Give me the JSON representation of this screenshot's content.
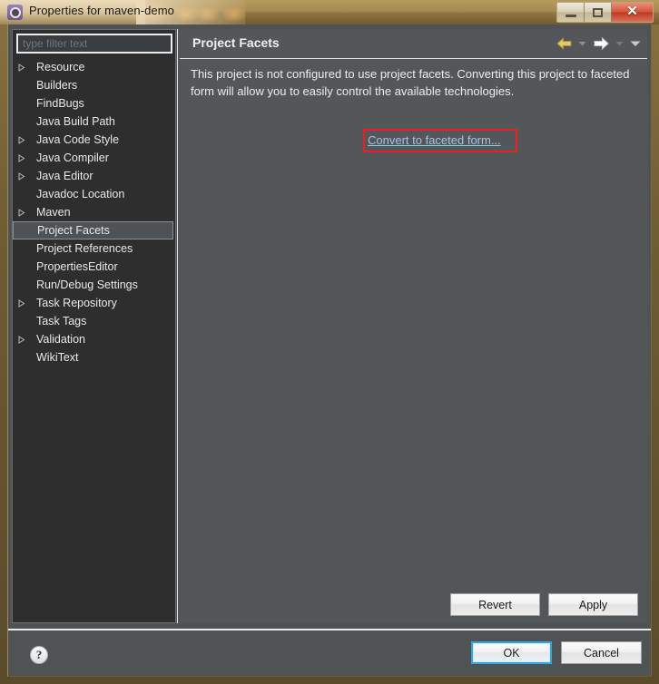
{
  "window": {
    "title": "Properties for maven-demo",
    "icon": "gear-icon",
    "controls": {
      "minimize_label": "",
      "maximize_label": "",
      "close_label": "✕"
    }
  },
  "sidebar": {
    "filter": {
      "placeholder": "type filter text",
      "value": ""
    },
    "items": [
      {
        "label": "Resource",
        "expandable": true,
        "selected": false
      },
      {
        "label": "Builders",
        "expandable": false,
        "selected": false
      },
      {
        "label": "FindBugs",
        "expandable": false,
        "selected": false
      },
      {
        "label": "Java Build Path",
        "expandable": false,
        "selected": false
      },
      {
        "label": "Java Code Style",
        "expandable": true,
        "selected": false
      },
      {
        "label": "Java Compiler",
        "expandable": true,
        "selected": false
      },
      {
        "label": "Java Editor",
        "expandable": true,
        "selected": false
      },
      {
        "label": "Javadoc Location",
        "expandable": false,
        "selected": false
      },
      {
        "label": "Maven",
        "expandable": true,
        "selected": false
      },
      {
        "label": "Project Facets",
        "expandable": false,
        "selected": true
      },
      {
        "label": "Project References",
        "expandable": false,
        "selected": false
      },
      {
        "label": "PropertiesEditor",
        "expandable": false,
        "selected": false
      },
      {
        "label": "Run/Debug Settings",
        "expandable": false,
        "selected": false
      },
      {
        "label": "Task Repository",
        "expandable": true,
        "selected": false
      },
      {
        "label": "Task Tags",
        "expandable": false,
        "selected": false
      },
      {
        "label": "Validation",
        "expandable": true,
        "selected": false
      },
      {
        "label": "WikiText",
        "expandable": false,
        "selected": false
      }
    ]
  },
  "content": {
    "title": "Project Facets",
    "description": "This project is not configured to use project facets. Converting this project to faceted form will allow you to easily control the available technologies.",
    "link_label": "Convert to faceted form...",
    "nav": {
      "back_icon": "back-arrow-icon",
      "back_menu_icon": "chevron-down-icon",
      "forward_icon": "forward-arrow-icon",
      "forward_menu_icon": "chevron-down-icon",
      "overflow_icon": "chevron-down-icon"
    },
    "revert_label": "Revert",
    "apply_label": "Apply"
  },
  "footer": {
    "help_label": "?",
    "ok_label": "OK",
    "cancel_label": "Cancel"
  },
  "colors": {
    "dialog_bg": "#4f5356",
    "content_bg": "#53575a",
    "tree_bg": "#2e2e2e",
    "title_bar": "#b79a5e",
    "link": "#9fc4e8",
    "annotation_red": "#f41d1d",
    "focus_blue": "#2fa8e0",
    "back_arrow": "#e8c56a",
    "forward_arrow": "#ffffff"
  }
}
